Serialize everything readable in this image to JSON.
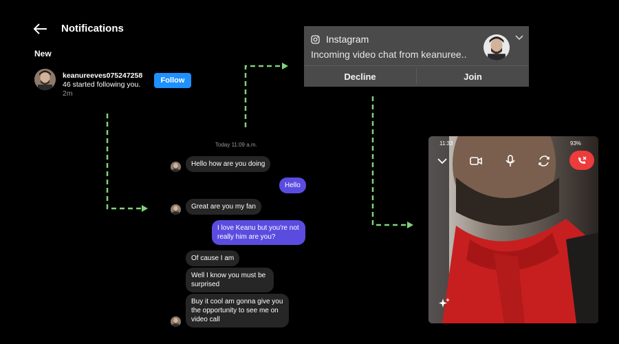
{
  "notifications": {
    "title": "Notifications",
    "section_label": "New",
    "item": {
      "username": "keanureeves075247258",
      "text": "46 started following you.",
      "time": "2m",
      "follow_label": "Follow"
    }
  },
  "incoming_call": {
    "app_name": "Instagram",
    "message": "Incoming video chat from keanuree..",
    "decline_label": "Decline",
    "join_label": "Join"
  },
  "chat": {
    "date_label": "Today 11:09 a.m.",
    "messages": [
      {
        "from": "them",
        "text": "Hello how are you doing"
      },
      {
        "from": "me",
        "text": "Hello"
      },
      {
        "from": "them",
        "text": "Great are you my fan"
      },
      {
        "from": "me",
        "text": "I love Keanu but you're not really him are you?"
      },
      {
        "from": "them",
        "text": "Of cause I am"
      },
      {
        "from": "them",
        "text": "Well I know you must be surprised"
      },
      {
        "from": "them",
        "text": "Buy it cool am gonna give you the opportunity to see me on video call"
      }
    ]
  },
  "video_call": {
    "status_time": "11:33",
    "battery": "93%"
  },
  "colors": {
    "background": "#000000",
    "follow_button": "#1e90ff",
    "outgoing_bubble": "#5b4ce0",
    "incoming_bubble": "#262626",
    "arrow": "#7fd47a",
    "end_call": "#ee3b3b"
  },
  "icons": [
    "back-arrow-icon",
    "instagram-icon",
    "chevron-down-icon",
    "video-camera-icon",
    "microphone-icon",
    "flip-camera-icon",
    "end-call-icon",
    "sparkle-icon"
  ]
}
